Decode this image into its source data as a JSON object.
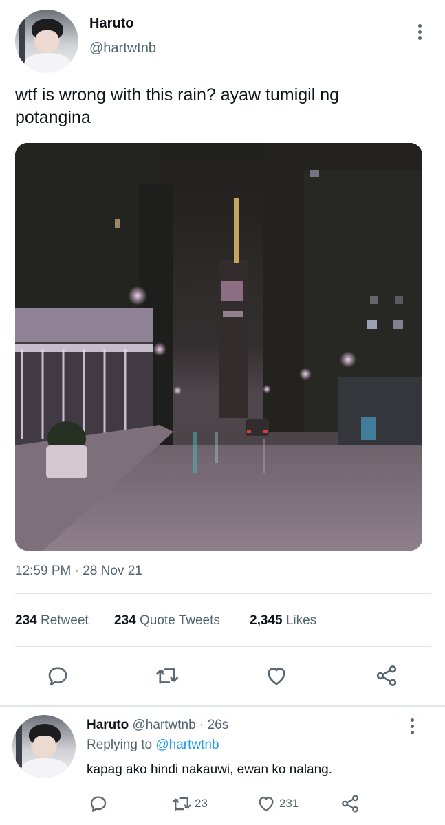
{
  "tweet": {
    "author_name": "Haruto",
    "author_handle": "@hartwtnb",
    "text": "wtf is wrong with this rain? ayaw tumigil ng potangina",
    "timestamp": "12:59 PM · 28 Nov 21",
    "stats": {
      "retweets_count": "234",
      "retweets_label": "Retweet",
      "quotes_count": "234",
      "quotes_label": "Quote Tweets",
      "likes_count": "2,345",
      "likes_label": "Likes"
    },
    "actions": {
      "reply_icon": "reply-icon",
      "retweet_icon": "retweet-icon",
      "like_icon": "heart-icon",
      "share_icon": "share-icon"
    }
  },
  "reply": {
    "author_name": "Haruto",
    "author_handle": "@hartwtnb",
    "time": "· 26s",
    "replying_prefix": "Replying to",
    "replying_to": "@hartwtnb",
    "text": "kapag ako hindi nakauwi, ewan ko nalang.",
    "retweet_count": "23",
    "like_count": "231"
  },
  "colors": {
    "accent": "#1d9bf0",
    "text": "#0f1419",
    "secondary": "#536471",
    "icon": "#5b6670",
    "divider": "#e1e5e8"
  }
}
